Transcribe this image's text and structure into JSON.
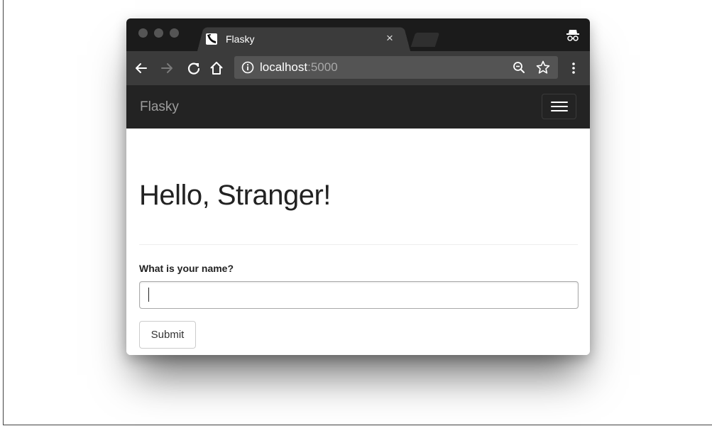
{
  "browser": {
    "tab": {
      "title": "Flasky",
      "close_glyph": "×",
      "favicon": "flask-horn-favicon-icon"
    },
    "address_bar": {
      "host": "localhost",
      "port": ":5000"
    },
    "toolbar_icons": [
      "back-arrow-icon",
      "forward-arrow-icon",
      "reload-icon",
      "home-icon",
      "info-icon",
      "zoom-icon",
      "star-icon",
      "menu-kebab-icon",
      "incognito-icon"
    ],
    "colors": {
      "tab_strip": "#1b1b1b",
      "toolbar": "#3b3b3b",
      "omnibox": "#545454"
    }
  },
  "navbar": {
    "brand": "Flasky",
    "toggle_icon": "hamburger-menu-icon",
    "background": "#232323"
  },
  "main": {
    "heading": "Hello, Stranger!",
    "form": {
      "label": "What is your name?",
      "input_value": "",
      "submit_label": "Submit"
    }
  }
}
